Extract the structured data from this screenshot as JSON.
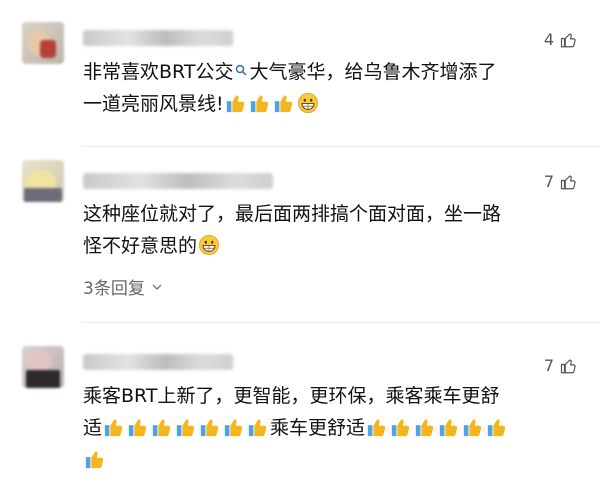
{
  "comments": [
    {
      "likes": "4",
      "text_lines": [
        "非常喜欢BRT公交",
        "大气豪华，给乌鲁木齐增添了",
        "一道亮丽风景线!"
      ],
      "icons": [
        "search-icon",
        "thumbs-up-icon",
        "grinning-face-icon"
      ]
    },
    {
      "likes": "7",
      "text_lines": [
        "这种座位就对了，最后面两排搞个面对面，坐一路",
        "怪不好意思的"
      ],
      "replies_label": "3条回复",
      "icons": [
        "thumbs-up-icon",
        "grinning-face-icon",
        "chevron-down-icon"
      ]
    },
    {
      "likes": "7",
      "text_lines": [
        "乘客BRT上新了，更智能，更环保，乘客乘车更舒",
        "适",
        "乘车更舒适"
      ],
      "icons": [
        "thumbs-up-icon"
      ]
    }
  ],
  "colors": {
    "text": "#111111",
    "muted": "#666666",
    "thumb": "#f5b51c",
    "divider": "#ececec"
  }
}
